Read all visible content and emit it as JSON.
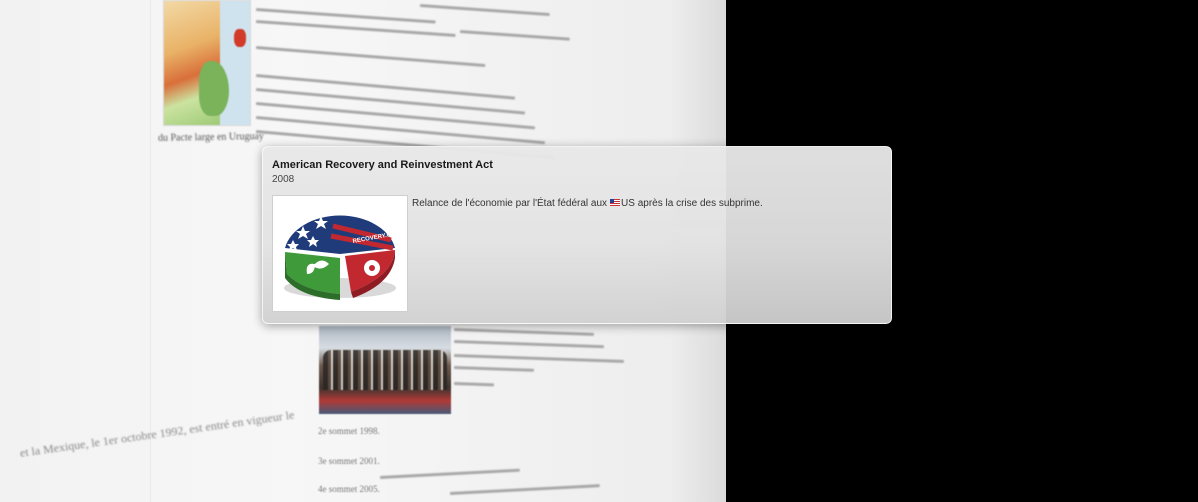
{
  "popup": {
    "title": "American Recovery and Reinvestment Act",
    "year": "2008",
    "description_before": "Relance de l'économie par l'État fédéral aux",
    "description_after": "US après la crise des subprime.",
    "flag_icon": "us-flag-icon",
    "image_icon": "recovery-gov-logo-icon",
    "logo_text": "RECOVERY.GOV"
  },
  "background": {
    "map_caption": "du Pacte large en Uruguay",
    "timeline": [
      "2e sommet 1998.",
      "3e sommet 2001.",
      "4e sommet 2005."
    ],
    "bottom_caption": "et la Mexique, le 1er octobre 1992, est entré en vigueur le"
  },
  "colors": {
    "logo_blue": "#1f3b7a",
    "logo_green": "#3f9a3a",
    "logo_red": "#c2282f"
  }
}
